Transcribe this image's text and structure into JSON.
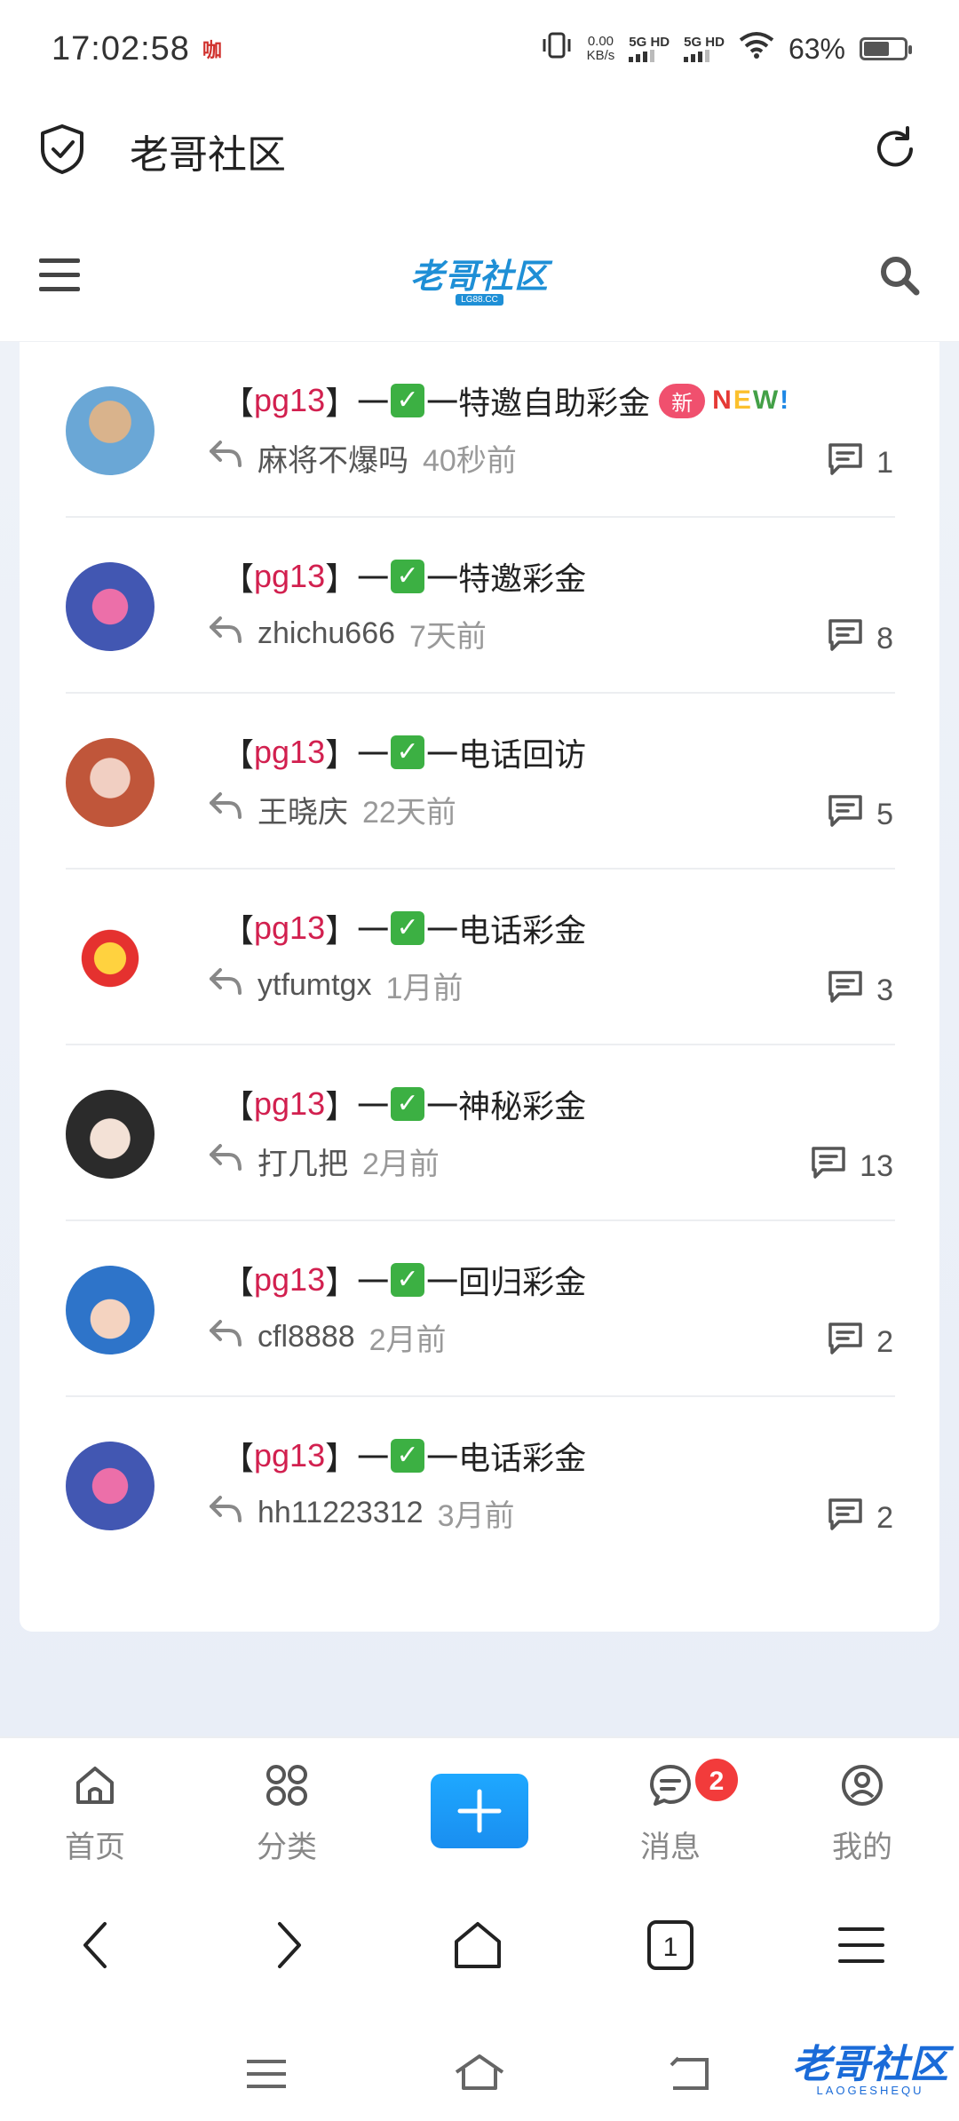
{
  "status_bar": {
    "time": "17:02:58",
    "app_badge": "咖",
    "net_speed_value": "0.00",
    "net_speed_unit": "KB/s",
    "sim1": "5G HD",
    "sim2": "5G HD",
    "battery": "63%",
    "battery_level": 0.63
  },
  "browser": {
    "title": "老哥社区"
  },
  "site": {
    "logo_text": "老哥社区",
    "logo_sub": "LG88.CC"
  },
  "topics": [
    {
      "tag": "pg13",
      "title_prefix": "【",
      "title_mid": "】一",
      "check": "✓",
      "title_suffix": "一特邀自助彩金",
      "badge": "新",
      "new_word": [
        "N",
        "E",
        "W",
        "!"
      ],
      "author": "麻将不爆吗",
      "time": "40秒前",
      "replies": "1"
    },
    {
      "tag": "pg13",
      "title_prefix": "【",
      "title_mid": "】一",
      "check": "✓",
      "title_suffix": "一特邀彩金",
      "author": "zhichu666",
      "time": "7天前",
      "replies": "8"
    },
    {
      "tag": "pg13",
      "title_prefix": "【",
      "title_mid": "】一",
      "check": "✓",
      "title_suffix": "一电话回访",
      "author": "王晓庆",
      "time": "22天前",
      "replies": "5"
    },
    {
      "tag": "pg13",
      "title_prefix": "【",
      "title_mid": "】一",
      "check": "✓",
      "title_suffix": "一电话彩金",
      "author": "ytfumtgx",
      "time": "1月前",
      "replies": "3"
    },
    {
      "tag": "pg13",
      "title_prefix": "【",
      "title_mid": "】一",
      "check": "✓",
      "title_suffix": "一神秘彩金",
      "author": "打几把",
      "time": "2月前",
      "replies": "13"
    },
    {
      "tag": "pg13",
      "title_prefix": "【",
      "title_mid": "】一",
      "check": "✓",
      "title_suffix": "一回归彩金",
      "author": "cfl8888",
      "time": "2月前",
      "replies": "2"
    },
    {
      "tag": "pg13",
      "title_prefix": "【",
      "title_mid": "】一",
      "check": "✓",
      "title_suffix": "一电话彩金",
      "author": "hh11223312",
      "time": "3月前",
      "replies": "2"
    }
  ],
  "bottom_nav": {
    "home": "首页",
    "category": "分类",
    "add": "+",
    "messages": "消息",
    "messages_badge": "2",
    "mine": "我的"
  },
  "browser_toolbar": {
    "tabs_count": "1"
  },
  "watermark": {
    "main": "老哥社区",
    "sub": "LAOGESHEQU"
  },
  "colors": {
    "accent": "#1a8ef0",
    "tag_red": "#d2204f",
    "badge_red": "#f23b3b"
  }
}
